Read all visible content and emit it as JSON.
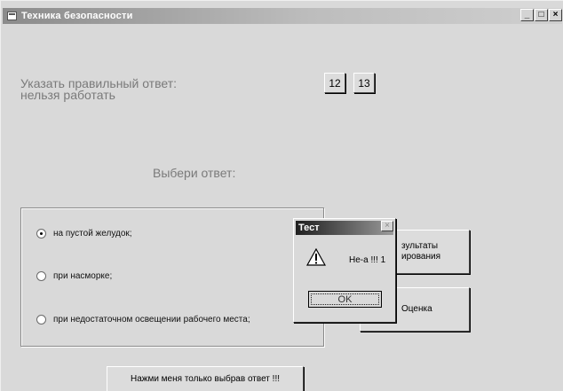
{
  "window": {
    "title": "Техника безопасности",
    "controls": {
      "minimize": "_",
      "maximize": "□",
      "close": "×"
    }
  },
  "prompt": {
    "line1": "Указать правильный ответ:",
    "line2": "нельзя работать"
  },
  "question_buttons": [
    "12",
    "13"
  ],
  "choose_label": "Выбери ответ:",
  "options": [
    {
      "label": "на пустой желудок;",
      "selected": true
    },
    {
      "label": "при насморке;",
      "selected": false
    },
    {
      "label": "при недостаточном освещении рабочего места;",
      "selected": false
    }
  ],
  "side_buttons": {
    "results_line1": "зультаты",
    "results_line2": "ирования",
    "score": "Оценка"
  },
  "dialog": {
    "title": "Тест",
    "close": "×",
    "icon": "warning-icon",
    "message": "Не-а !!!  1",
    "ok": "OK"
  },
  "submit_button": "Нажми меня только выбрав ответ !!!"
}
